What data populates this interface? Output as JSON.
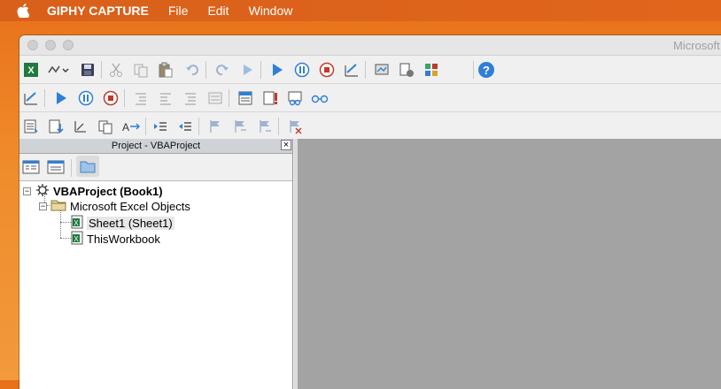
{
  "menubar": {
    "apple_icon": "apple-icon",
    "app_name": "GIPHY CAPTURE",
    "items": [
      "File",
      "Edit",
      "Window"
    ]
  },
  "window": {
    "title": "Microsoft"
  },
  "toolbar1": {
    "icons": [
      "excel-icon",
      "insert-userform-icon",
      "save-icon",
      "cut-icon",
      "copy-icon",
      "paste-icon",
      "undo-icon",
      "redo-icon",
      "run-icon-disabled",
      "run-icon",
      "pause-icon",
      "stop-icon",
      "design-mode-icon",
      "project-explorer-icon",
      "properties-icon",
      "object-browser-icon",
      "help-icon"
    ]
  },
  "toolbar2": {
    "icons": [
      "design-mode-icon",
      "run-icon",
      "pause-icon",
      "stop-icon",
      "indent-icon",
      "outdent-icon",
      "comment-icon",
      "uncomment-icon",
      "list-properties-icon",
      "quick-info-icon",
      "watch-icon",
      "glasses-icon"
    ]
  },
  "toolbar3": {
    "icons": [
      "list-icon",
      "step-icon",
      "complete-word-icon",
      "parameter-icon",
      "ab-arrow-icon",
      "indent-icon",
      "outdent-icon",
      "bookmark-icon",
      "next-bookmark-icon",
      "prev-bookmark-icon",
      "clear-bookmarks-icon"
    ]
  },
  "project": {
    "title": "Project - VBAProject",
    "close": "×",
    "tree": {
      "root": "VBAProject (Book1)",
      "folder": "Microsoft Excel Objects",
      "items": [
        "Sheet1 (Sheet1)",
        "ThisWorkbook"
      ]
    }
  },
  "colors": {
    "accent_blue": "#2f7fd6",
    "stop_red": "#c0392b",
    "code_bg": "#a3a3a3"
  }
}
